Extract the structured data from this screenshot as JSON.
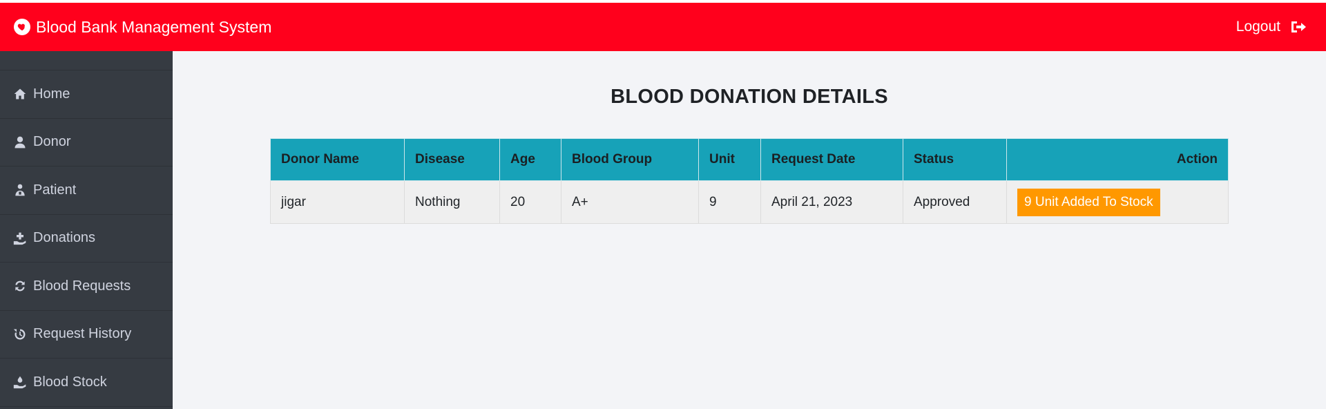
{
  "header": {
    "title": "Blood Bank Management System",
    "logout_label": "Logout",
    "brand_color": "#ff001c"
  },
  "sidebar": {
    "items": [
      {
        "label": "Home",
        "icon": "home-icon"
      },
      {
        "label": "Donor",
        "icon": "user-icon"
      },
      {
        "label": "Patient",
        "icon": "patient-icon"
      },
      {
        "label": "Donations",
        "icon": "donate-icon"
      },
      {
        "label": "Blood Requests",
        "icon": "refresh-icon"
      },
      {
        "label": "Request History",
        "icon": "history-icon"
      },
      {
        "label": "Blood Stock",
        "icon": "hand-drop-icon"
      }
    ]
  },
  "main": {
    "title": "BLOOD DONATION DETAILS",
    "table": {
      "headers": [
        "Donor Name",
        "Disease",
        "Age",
        "Blood Group",
        "Unit",
        "Request Date",
        "Status",
        "Action"
      ],
      "rows": [
        {
          "donor_name": "jigar",
          "disease": "Nothing",
          "age": "20",
          "blood_group": "A+",
          "unit": "9",
          "request_date": "April 21, 2023",
          "status": "Approved",
          "action": "9 Unit Added To Stock"
        }
      ]
    },
    "header_color": "#17a2b8",
    "badge_color": "#ff9800"
  }
}
